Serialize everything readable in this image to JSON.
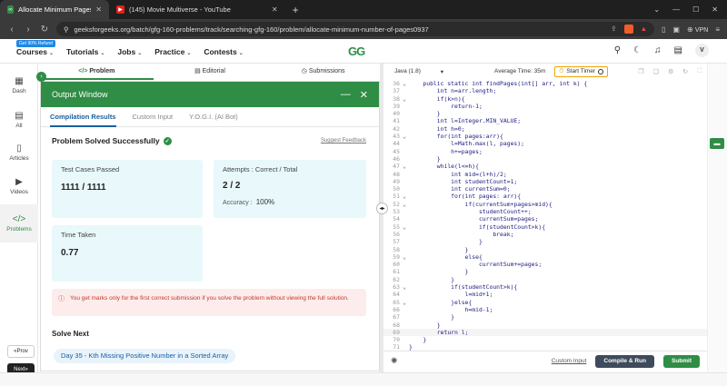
{
  "browser": {
    "tabs": [
      {
        "title": "Allocate Minimum Pages | Prac",
        "favicon": "gfg"
      },
      {
        "title": "(145) Movie Multiverse - YouTube",
        "favicon": "youtube"
      }
    ],
    "url": "geeksforgeeks.org/batch/gfg-160-problems/track/searching-gfg-160/problem/allocate-minimum-number-of-pages0937",
    "vpn_label": "VPN"
  },
  "header": {
    "refund_badge": "Get 90% Refund",
    "menu": [
      "Courses",
      "Tutorials",
      "Jobs",
      "Practice",
      "Contests"
    ],
    "logo": "GG",
    "avatar": "V"
  },
  "rail": {
    "items": [
      "Dash",
      "All",
      "Articles",
      "Videos",
      "Problems"
    ],
    "prev": "Prov",
    "next": "Next"
  },
  "problem_tabs": [
    "Problem",
    "Editorial",
    "Submissions"
  ],
  "output": {
    "title": "Output Window",
    "tabs": [
      "Compilation Results",
      "Custom Input",
      "Y.O.G.I. (AI Bot)"
    ],
    "status": "Problem Solved Successfully",
    "feedback": "Suggest Feedback",
    "test_label": "Test Cases Passed",
    "test_value": "1111 / 1111",
    "attempts_label": "Attempts : Correct / Total",
    "attempts_value": "2 / 2",
    "accuracy_label": "Accuracy :",
    "accuracy_value": "100%",
    "time_label": "Time Taken",
    "time_value": "0.77",
    "warning": "You get marks only for the first correct submission if you solve the problem without viewing the full solution.",
    "solve_next": "Solve Next",
    "next_problem": "Day 35 - Kth Missing Positive Number in a Sorted Array"
  },
  "editor": {
    "language": "Java (1.8)",
    "avg_time": "Average Time: 35m",
    "timer": "Start Timer",
    "lines": [
      {
        "n": "36",
        "fold": "⌄",
        "code": "    public static int findPages(int[] arr, int k) {"
      },
      {
        "n": "37",
        "fold": "",
        "code": "        int n=arr.length;"
      },
      {
        "n": "38",
        "fold": "⌄",
        "code": "        if(k>n){"
      },
      {
        "n": "39",
        "fold": "",
        "code": "            return-1;"
      },
      {
        "n": "40",
        "fold": "",
        "code": "        }"
      },
      {
        "n": "41",
        "fold": "",
        "code": "        int l=Integer.MIN_VALUE;"
      },
      {
        "n": "42",
        "fold": "",
        "code": "        int h=0;"
      },
      {
        "n": "43",
        "fold": "⌄",
        "code": "        for(int pages:arr){"
      },
      {
        "n": "44",
        "fold": "",
        "code": "            l=Math.max(l, pages);"
      },
      {
        "n": "45",
        "fold": "",
        "code": "            h+=pages;"
      },
      {
        "n": "46",
        "fold": "",
        "code": "        }"
      },
      {
        "n": "47",
        "fold": "⌄",
        "code": "        while(l<=h){"
      },
      {
        "n": "48",
        "fold": "",
        "code": "            int mid=(l+h)/2;"
      },
      {
        "n": "49",
        "fold": "",
        "code": "            int studentCount=1;"
      },
      {
        "n": "50",
        "fold": "",
        "code": "            int currentSum=0;"
      },
      {
        "n": "51",
        "fold": "⌄",
        "code": "            for(int pages: arr){"
      },
      {
        "n": "52",
        "fold": "⌄",
        "code": "                if(currentSum+pages>mid){"
      },
      {
        "n": "53",
        "fold": "",
        "code": "                    studentCount++;"
      },
      {
        "n": "54",
        "fold": "",
        "code": "                    currentSum=pages;"
      },
      {
        "n": "55",
        "fold": "⌄",
        "code": "                    if(studentCount>k){"
      },
      {
        "n": "56",
        "fold": "",
        "code": "                        break;"
      },
      {
        "n": "57",
        "fold": "",
        "code": "                    }"
      },
      {
        "n": "58",
        "fold": "",
        "code": "                }"
      },
      {
        "n": "59",
        "fold": "⌄",
        "code": "                else{"
      },
      {
        "n": "60",
        "fold": "",
        "code": "                    currentSum+=pages;"
      },
      {
        "n": "61",
        "fold": "",
        "code": "                }"
      },
      {
        "n": "62",
        "fold": "",
        "code": "            }"
      },
      {
        "n": "63",
        "fold": "⌄",
        "code": "            if(studentCount>k){"
      },
      {
        "n": "64",
        "fold": "",
        "code": "                l=mid+1;"
      },
      {
        "n": "65",
        "fold": "⌄",
        "code": "            }else{"
      },
      {
        "n": "66",
        "fold": "",
        "code": "                h=mid-1;"
      },
      {
        "n": "67",
        "fold": "",
        "code": "            }"
      },
      {
        "n": "68",
        "fold": "",
        "code": "        }"
      },
      {
        "n": "69",
        "fold": "",
        "code": "        return l;"
      },
      {
        "n": "70",
        "fold": "",
        "code": "    }"
      },
      {
        "n": "71",
        "fold": "",
        "code": "}"
      }
    ],
    "highlight_line": "69",
    "custom_input": "Custom Input",
    "compile": "Compile & Run",
    "submit": "Submit"
  }
}
